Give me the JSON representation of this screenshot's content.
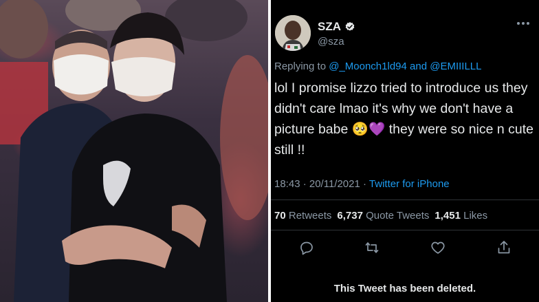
{
  "photo": {
    "alt_icon": "concert-photo"
  },
  "tweet": {
    "display_name": "SZA",
    "handle": "@sza",
    "replying_prefix": "Replying to",
    "replying_users": "@_Moonch1ld94 and @EMIIILLL",
    "text": "lol I promise lizzo tried to introduce us they didn't care lmao it's why we don't have a picture babe 🥺💜 they were so nice n cute still !!",
    "time": "18:43 · 20/11/2021 ·",
    "source": "Twitter for iPhone",
    "retweets_count": "70",
    "retweets_label": "Retweets",
    "quotes_count": "6,737",
    "quotes_label": "Quote Tweets",
    "likes_count": "1,451",
    "likes_label": "Likes",
    "deleted_notice": "This Tweet has been deleted."
  },
  "colors": {
    "link": "#1d9bf0",
    "muted": "#8b98a5",
    "text": "#e7e9ea",
    "background": "#000000"
  }
}
